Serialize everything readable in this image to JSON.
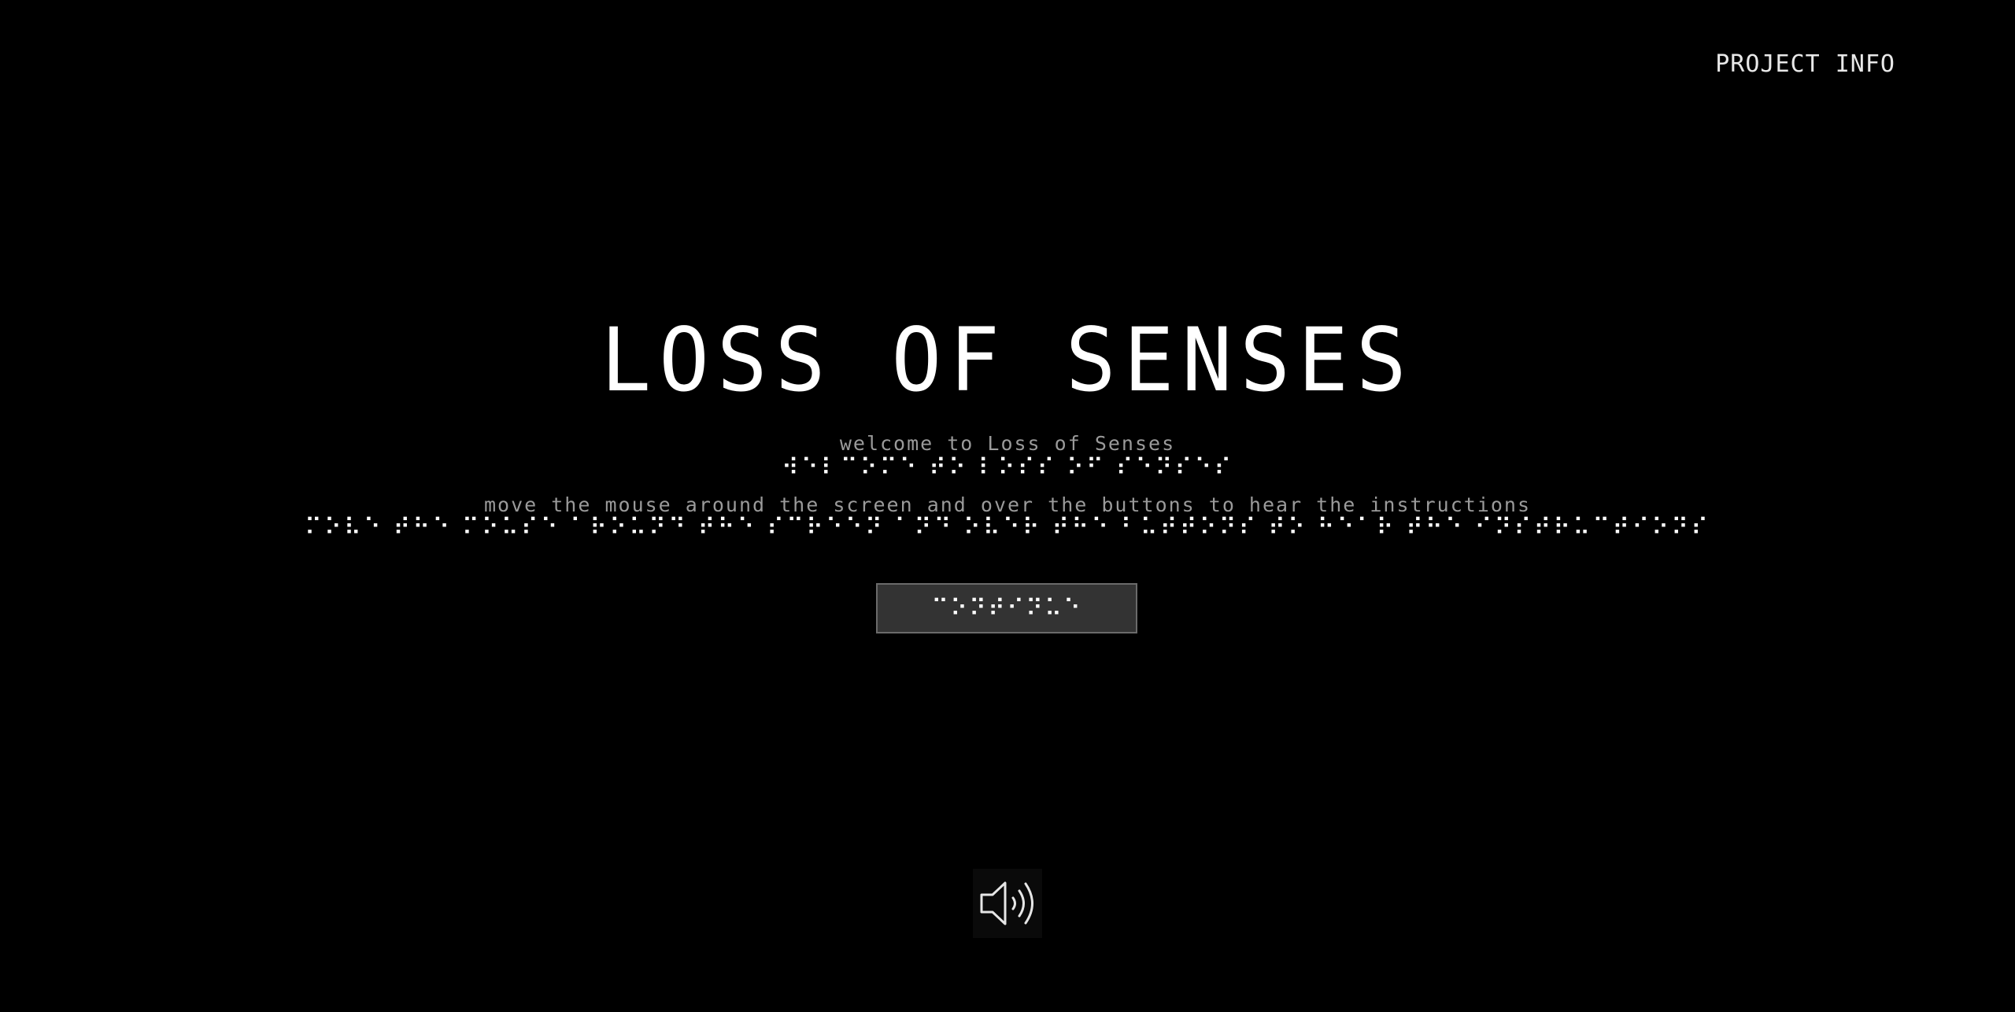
{
  "header": {
    "project_info_label": "PROJECT INFO"
  },
  "main": {
    "title": "LOSS OF SENSES",
    "welcome_text": "welcome to Loss of Senses",
    "welcome_braille": "⠺⠑⠇⠉⠕⠍⠑ ⠞⠕ ⠇⠕⠎⠎ ⠕⠋ ⠎⠑⠝⠎⠑⠎",
    "instructions_text": "move the mouse around the screen and over the buttons to hear the instructions",
    "instructions_braille": "⠍⠕⠧⠑ ⠞⠓⠑ ⠍⠕⠥⠎⠑ ⠁⠗⠕⠥⠝⠙ ⠞⠓⠑ ⠎⠉⠗⠑⠑⠝ ⠁⠝⠙ ⠕⠧⠑⠗ ⠞⠓⠑ ⠃⠥⠞⠞⠕⠝⠎ ⠞⠕ ⠓⠑⠁⠗ ⠞⠓⠑ ⠊⠝⠎⠞⠗⠥⠉⠞⠊⠕⠝⠎",
    "start_button_braille": "⠉⠕⠝⠞⠊⠝⠥⠑"
  },
  "footer": {
    "sound_icon": "speaker-volume-icon"
  },
  "colors": {
    "background": "#000000",
    "text": "#ffffff",
    "muted_text": "#9a9a9a",
    "button_bg": "#333333",
    "button_border": "#6a6a6a"
  }
}
